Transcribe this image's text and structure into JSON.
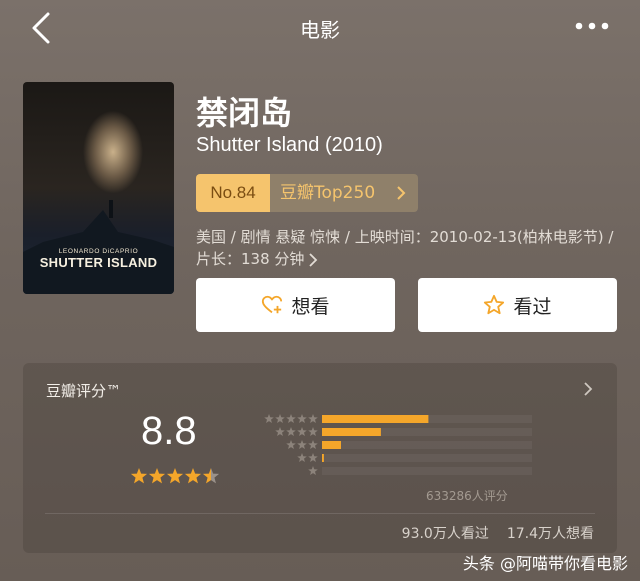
{
  "nav": {
    "title": "电影"
  },
  "movie": {
    "cn_title": "禁闭岛",
    "en_title": "Shutter Island (2010)",
    "poster": {
      "credit": "LEONARDO DiCAPRIO",
      "title": "SHUTTER ISLAND"
    },
    "rank": {
      "no": "No.84",
      "label": "豆瓣Top250"
    },
    "info": "美国 / 剧情 悬疑 惊悚 / 上映时间：2010-02-13(柏林电影节) / 片长：138 分钟"
  },
  "actions": {
    "want": "想看",
    "seen": "看过"
  },
  "rating": {
    "title": "豆瓣评分™",
    "score": "8.8",
    "stars_value": 4.5,
    "distribution": [
      {
        "stars": 5,
        "fraction": 0.56
      },
      {
        "stars": 4,
        "fraction": 0.31
      },
      {
        "stars": 3,
        "fraction": 0.1
      },
      {
        "stars": 2,
        "fraction": 0.01
      },
      {
        "stars": 1,
        "fraction": 0.0
      }
    ],
    "count": "633286人评分",
    "seen": "93.0万人看过",
    "want": "17.4万人想看"
  },
  "colors": {
    "accent": "#f5c46d",
    "accent_dark": "#8f806a",
    "star": "#f4a62a"
  },
  "watermark": "头条 @阿喵带你看电影"
}
